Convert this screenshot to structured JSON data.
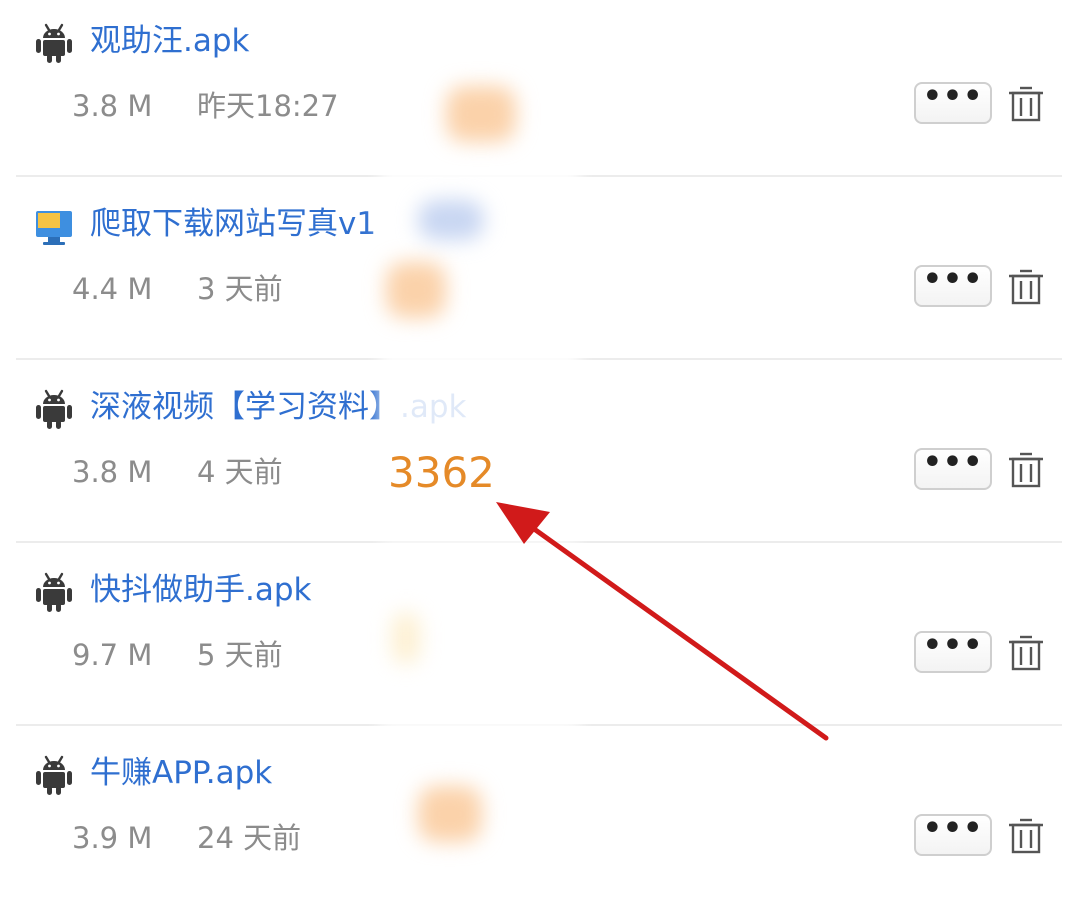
{
  "files": [
    {
      "name": "观助汪.apk",
      "size": "3.8 M",
      "time": "昨天18:27",
      "icon": "android-icon"
    },
    {
      "name": "爬取下载网站写真v1",
      "size": "4.4 M",
      "time": "3 天前",
      "icon": "monitor-icon"
    },
    {
      "name": "深液视频【学习资料】.apk",
      "size": "3.8 M",
      "time": "4 天前",
      "icon": "android-icon"
    },
    {
      "name": "快抖做助手.apk",
      "size": "9.7 M",
      "time": "5 天前",
      "icon": "android-icon"
    },
    {
      "name": "牛赚APP.apk",
      "size": "3.9 M",
      "time": "24 天前",
      "icon": "android-icon"
    }
  ],
  "actions": {
    "more_label": "•••",
    "more_icon": "more-dots-icon",
    "delete_icon": "trash-icon"
  },
  "annotation": {
    "count": "3362",
    "count_color": "#e58a28",
    "arrow_color": "#d11a1a"
  },
  "colors": {
    "link": "#2f6fd0",
    "meta": "#8c8c8c",
    "divider": "#ececec"
  }
}
